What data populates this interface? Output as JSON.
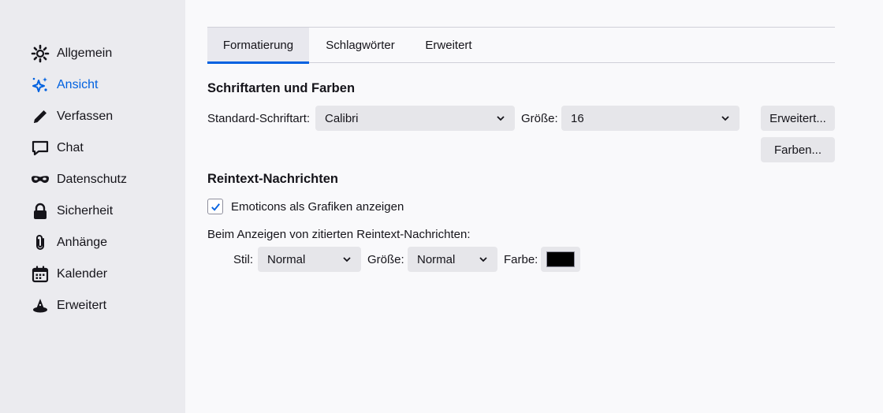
{
  "sidebar": {
    "items": [
      {
        "label": "Allgemein",
        "icon": "gear-icon"
      },
      {
        "label": "Ansicht",
        "icon": "sparkle-icon",
        "active": true
      },
      {
        "label": "Verfassen",
        "icon": "pencil-icon"
      },
      {
        "label": "Chat",
        "icon": "chat-icon"
      },
      {
        "label": "Datenschutz",
        "icon": "mask-icon"
      },
      {
        "label": "Sicherheit",
        "icon": "lock-icon"
      },
      {
        "label": "Anhänge",
        "icon": "paperclip-icon"
      },
      {
        "label": "Kalender",
        "icon": "calendar-icon"
      },
      {
        "label": "Erweitert",
        "icon": "wizard-hat-icon"
      }
    ]
  },
  "tabs": [
    {
      "label": "Formatierung",
      "selected": true
    },
    {
      "label": "Schlagwörter"
    },
    {
      "label": "Erweitert"
    }
  ],
  "fonts_colors": {
    "heading": "Schriftarten und Farben",
    "default_font_label": "Standard-Schriftart:",
    "default_font_value": "Calibri",
    "size_label": "Größe:",
    "size_value": "16",
    "advanced_button": "Erweitert...",
    "colors_button": "Farben..."
  },
  "plaintext": {
    "heading": "Reintext-Nachrichten",
    "emoticons_label": "Emoticons als Grafiken anzeigen",
    "emoticons_checked": true,
    "quoted_label": "Beim Anzeigen von zitierten Reintext-Nachrichten:",
    "style_label": "Stil:",
    "style_value": "Normal",
    "size_label": "Größe:",
    "size_value": "Normal",
    "color_label": "Farbe:",
    "color_value": "#000000"
  },
  "colors": {
    "accent": "#0061e0",
    "sidebar_bg": "#ebebef",
    "content_bg": "#f9f9fb"
  }
}
